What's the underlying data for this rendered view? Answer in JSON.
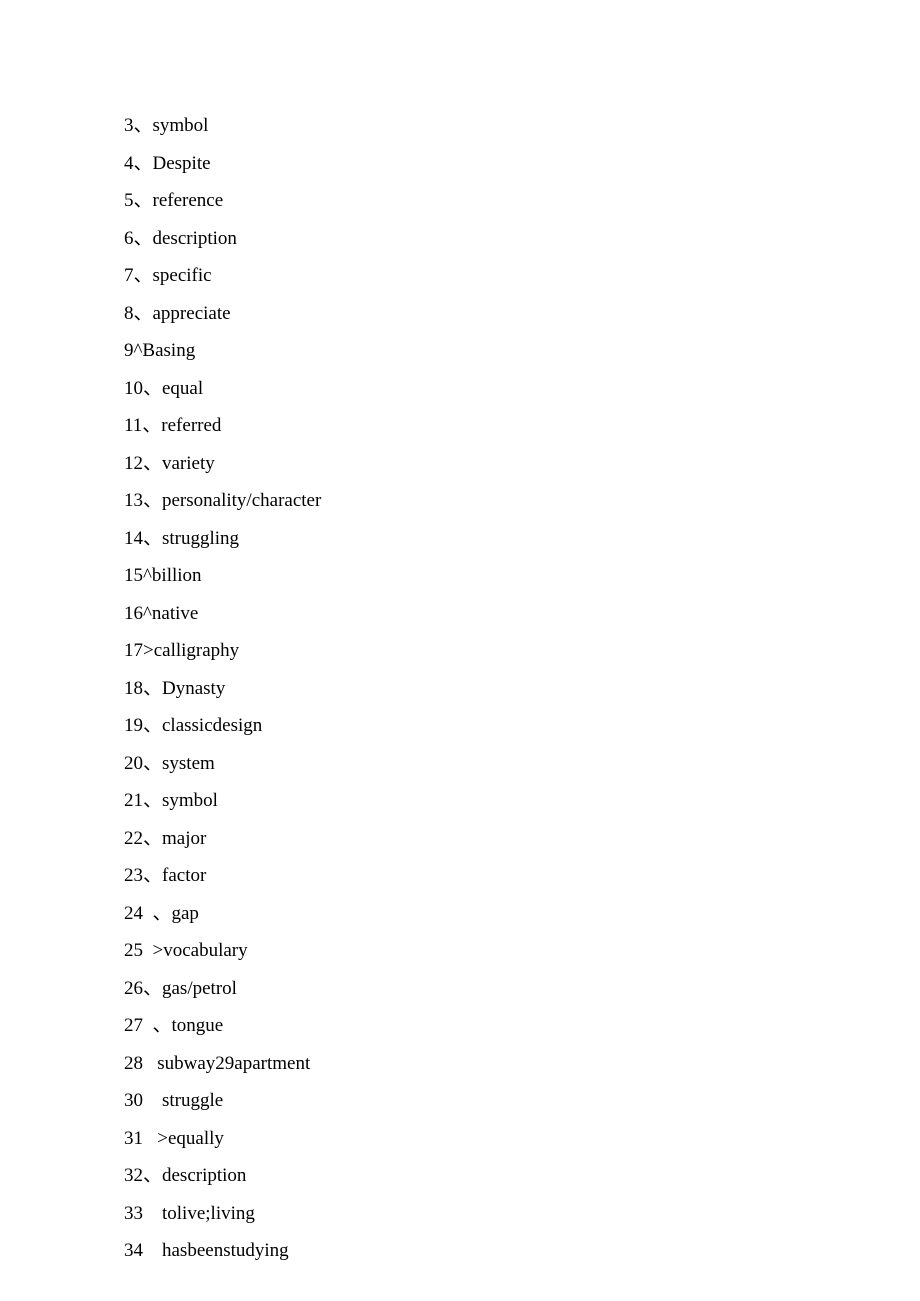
{
  "items": [
    "3、symbol",
    "4、Despite",
    "5、reference",
    "6、description",
    "7、specific",
    "8、appreciate",
    "9^Basing",
    "10、equal",
    "11、referred",
    "12、variety",
    "13、personality/character",
    "14、struggling",
    "15^billion",
    "16^native",
    "17>calligraphy",
    "18、Dynasty",
    "19、classicdesign",
    "20、system",
    "21、symbol",
    "22、major",
    "23、factor",
    "24  、gap",
    "25  >vocabulary",
    "26、gas/petrol",
    "27  、tongue",
    "28   subway29apartment",
    "30    struggle",
    "31   >equally",
    "32、description",
    "33    tolive;living",
    "34    hasbeenstudying"
  ]
}
